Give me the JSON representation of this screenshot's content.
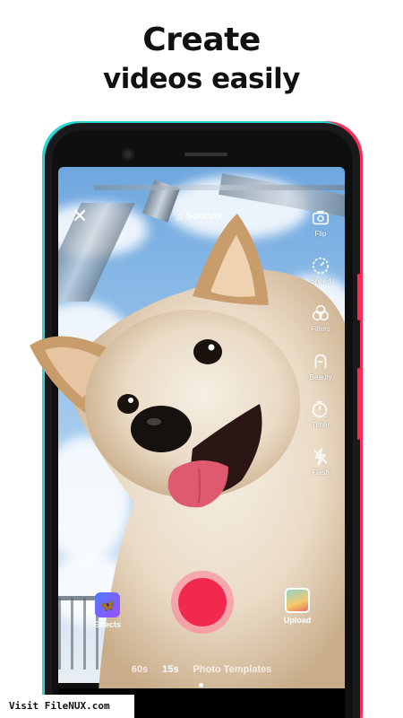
{
  "headline": {
    "line1": "Create",
    "line2": "videos easily"
  },
  "camera": {
    "sound_label": "Sounds",
    "tools": [
      {
        "label": "Flip",
        "icon": "flip-camera-icon"
      },
      {
        "label": "Speed",
        "icon": "speed-icon"
      },
      {
        "label": "Filters",
        "icon": "filters-icon"
      },
      {
        "label": "Beauty",
        "icon": "beauty-icon"
      },
      {
        "label": "Timer",
        "icon": "timer-icon"
      },
      {
        "label": "Flash",
        "icon": "flash-icon"
      }
    ],
    "effects_label": "Effects",
    "upload_label": "Upload",
    "modes": [
      "60s",
      "15s",
      "Photo Templates"
    ],
    "active_mode": "15s"
  },
  "watermark": "Visit FileNUX.com",
  "colors": {
    "record": "#f2294f",
    "accent_cyan": "#2ad6d0",
    "accent_pink": "#ff2a55"
  }
}
